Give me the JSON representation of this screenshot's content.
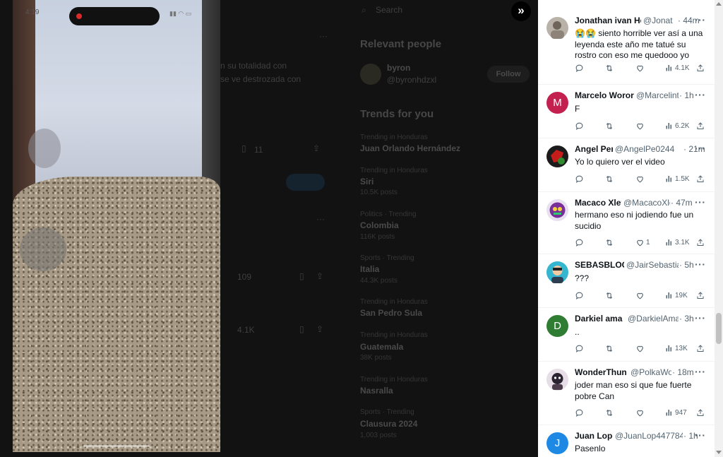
{
  "background": {
    "search_placeholder": "Search",
    "relevant_people_title": "Relevant people",
    "person_name": "byron",
    "person_handle": "@byronhdzxl",
    "follow_label": "Follow",
    "trends_title": "Trends for you",
    "tweet_snippet_1": "n su totalidad con",
    "tweet_snippet_2": "se ve destrozada con",
    "trends": [
      {
        "context": "Trending in Honduras",
        "name": "Juan Orlando Hernández",
        "posts": ""
      },
      {
        "context": "Trending in Honduras",
        "name": "Siri",
        "posts": "10.5K posts"
      },
      {
        "context": "Politics · Trending",
        "name": "Colombia",
        "posts": "116K posts"
      },
      {
        "context": "Sports · Trending",
        "name": "Italia",
        "posts": "44.3K posts"
      },
      {
        "context": "Trending in Honduras",
        "name": "San Pedro Sula",
        "posts": ""
      },
      {
        "context": "Trending in Honduras",
        "name": "Guatemala",
        "posts": "38K posts"
      },
      {
        "context": "Trending in Honduras",
        "name": "Nasralla",
        "posts": ""
      },
      {
        "context": "Sports · Trending",
        "name": "Clausura 2024",
        "posts": "1,003 posts"
      }
    ],
    "stat_1": "11",
    "stat_2": "109",
    "stat_3": "4.1K"
  },
  "video": {
    "status_time": "4:19"
  },
  "replies": [
    {
      "name": "Jonathan ivan He",
      "handle": "@Jonat",
      "time": "· 44m",
      "text": "😭😭 siento horrible ver así a una leyenda este año me tatué su rostro con eso me quedooo yo",
      "likes": "",
      "views": "4.1K",
      "avatar_color": "#8a8a8a",
      "avatar_letter": ""
    },
    {
      "name": "Marcelo Woror",
      "handle": "@Marcelint",
      "time": "· 1h",
      "text": "F",
      "likes": "",
      "views": "6.2K",
      "avatar_color": "#c4204f",
      "avatar_letter": "M"
    },
    {
      "name": "Angel Per",
      "handle": "@AngelPe0244",
      "time": "· 21m",
      "text": "Yo lo quiero ver el video",
      "likes": "",
      "views": "1.5K",
      "avatar_color": "#b01818",
      "avatar_letter": ""
    },
    {
      "name": "Macaco Xley",
      "handle": "@MacacoXle",
      "time": "· 47m",
      "text": "hermano eso ni jodiendo fue un sucidio",
      "likes": "1",
      "views": "3.1K",
      "avatar_color": "#6a2c8a",
      "avatar_letter": ""
    },
    {
      "name": "SEBASBLOC",
      "handle": "@JairSebastia",
      "time": "· 5h",
      "text": "???",
      "likes": "",
      "views": "19K",
      "avatar_color": "#2aa8c4",
      "avatar_letter": ""
    },
    {
      "name": "Darkiel ama",
      "handle": "@DarkielAma",
      "time": "· 3h",
      "text": "..",
      "likes": "",
      "views": "13K",
      "avatar_color": "#2e7d32",
      "avatar_letter": "D"
    },
    {
      "name": "WonderThun",
      "handle": "@PolkaWo",
      "time": "· 18m",
      "text": "joder man eso si que fue fuerte pobre Can",
      "likes": "",
      "views": "947",
      "avatar_color": "#3a2a3a",
      "avatar_letter": ""
    },
    {
      "name": "Juan Lope",
      "handle": "@JuanLop447784",
      "time": "· 1h",
      "text": "Pasenlo",
      "likes": "",
      "views": "",
      "avatar_color": "#1e88e5",
      "avatar_letter": "J"
    }
  ],
  "more_label": "···"
}
